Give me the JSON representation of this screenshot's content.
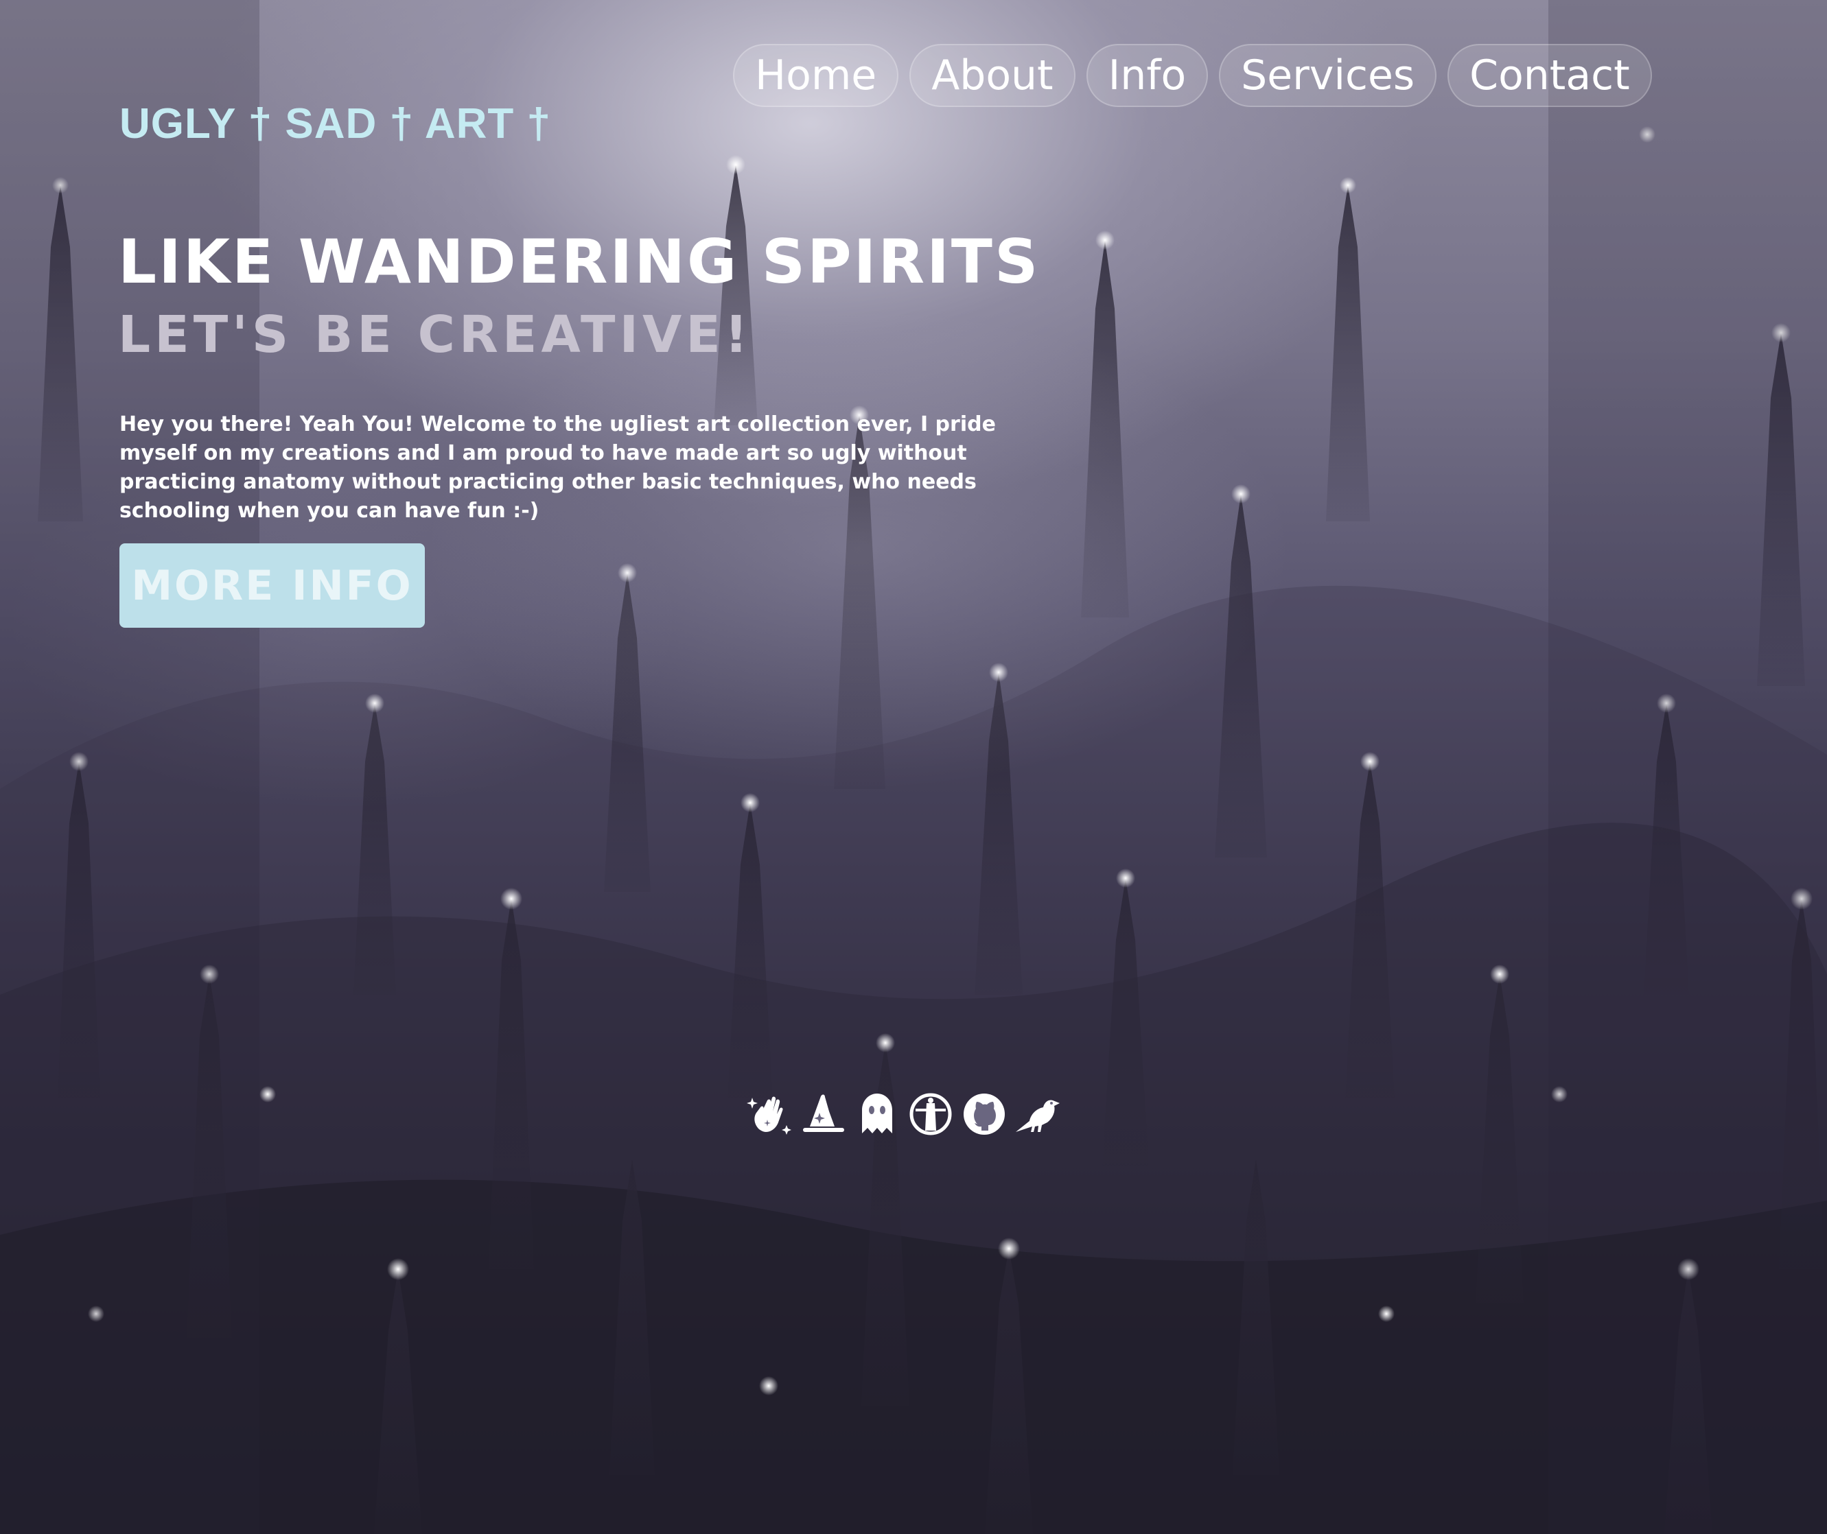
{
  "colors": {
    "brand": "#c5ebf2",
    "cta_background": "#bde0ea",
    "subtitle": "#c7c2cf",
    "text": "#ffffff"
  },
  "brand": {
    "name": "UGLY † SAD † ART †"
  },
  "nav": {
    "items": [
      {
        "label": "Home"
      },
      {
        "label": "About"
      },
      {
        "label": "Info"
      },
      {
        "label": "Services"
      },
      {
        "label": "Contact"
      }
    ]
  },
  "hero": {
    "title": "LIKE WANDERING SPIRITS",
    "subtitle": "LET'S BE CREATIVE!",
    "text": "Hey you there! Yeah You! Welcome to the ugliest art collection ever, I pride myself on my creations and I am proud to have made art so ugly without practicing anatomy without practicing other basic techniques, who needs schooling when you can have fun :-)",
    "cta_label": "MORE INFO"
  },
  "socials": {
    "icons": [
      "sparkle-hand-icon",
      "wizard-hat-icon",
      "ghost-icon",
      "lighthouse-icon",
      "github-icon",
      "crow-icon"
    ]
  }
}
